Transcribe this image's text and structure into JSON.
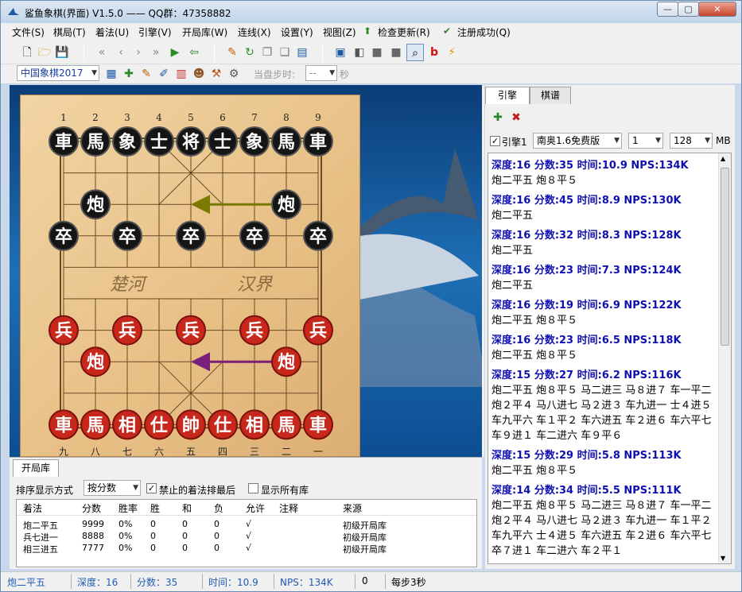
{
  "window": {
    "title": "鲨鱼象棋(界面) V1.5.0 —— QQ群：47358882",
    "min": "—",
    "max": "▢",
    "close": "✕"
  },
  "menu": [
    "文件(S)",
    "棋局(T)",
    "着法(U)",
    "引擎(V)",
    "开局库(W)",
    "连线(X)",
    "设置(Y)",
    "视图(Z)",
    "检查更新(R)",
    "注册成功(Q)"
  ],
  "toolbar2": {
    "board_style": "中国象棋2017",
    "step_label": "当盘步时:",
    "step_value": "--",
    "step_unit": "秒"
  },
  "board": {
    "top_numbers": [
      "1",
      "2",
      "3",
      "4",
      "5",
      "6",
      "7",
      "8",
      "9"
    ],
    "bottom_numbers": [
      "九",
      "八",
      "七",
      "六",
      "五",
      "四",
      "三",
      "二",
      "一"
    ],
    "river_left": "楚河",
    "river_right": "汉界",
    "black_pieces": [
      {
        "c": "車",
        "f": 0,
        "r": 0
      },
      {
        "c": "馬",
        "f": 1,
        "r": 0
      },
      {
        "c": "象",
        "f": 2,
        "r": 0
      },
      {
        "c": "士",
        "f": 3,
        "r": 0
      },
      {
        "c": "将",
        "f": 4,
        "r": 0
      },
      {
        "c": "士",
        "f": 5,
        "r": 0
      },
      {
        "c": "象",
        "f": 6,
        "r": 0
      },
      {
        "c": "馬",
        "f": 7,
        "r": 0
      },
      {
        "c": "車",
        "f": 8,
        "r": 0
      },
      {
        "c": "炮",
        "f": 1,
        "r": 2
      },
      {
        "c": "炮",
        "f": 7,
        "r": 2
      },
      {
        "c": "卒",
        "f": 0,
        "r": 3
      },
      {
        "c": "卒",
        "f": 2,
        "r": 3
      },
      {
        "c": "卒",
        "f": 4,
        "r": 3
      },
      {
        "c": "卒",
        "f": 6,
        "r": 3
      },
      {
        "c": "卒",
        "f": 8,
        "r": 3
      }
    ],
    "red_pieces": [
      {
        "c": "兵",
        "f": 0,
        "r": 6
      },
      {
        "c": "兵",
        "f": 2,
        "r": 6
      },
      {
        "c": "兵",
        "f": 4,
        "r": 6
      },
      {
        "c": "兵",
        "f": 6,
        "r": 6
      },
      {
        "c": "兵",
        "f": 8,
        "r": 6
      },
      {
        "c": "炮",
        "f": 1,
        "r": 7
      },
      {
        "c": "炮",
        "f": 7,
        "r": 7
      },
      {
        "c": "車",
        "f": 0,
        "r": 9
      },
      {
        "c": "馬",
        "f": 1,
        "r": 9
      },
      {
        "c": "相",
        "f": 2,
        "r": 9
      },
      {
        "c": "仕",
        "f": 3,
        "r": 9
      },
      {
        "c": "帥",
        "f": 4,
        "r": 9
      },
      {
        "c": "仕",
        "f": 5,
        "r": 9
      },
      {
        "c": "相",
        "f": 6,
        "r": 9
      },
      {
        "c": "馬",
        "f": 7,
        "r": 9
      },
      {
        "c": "車",
        "f": 8,
        "r": 9
      }
    ],
    "arrows": [
      {
        "from": [
          7,
          2
        ],
        "to": [
          4,
          2
        ],
        "color": "#7a7a00"
      },
      {
        "from": [
          7,
          7
        ],
        "to": [
          4,
          7
        ],
        "color": "#7a1f7a"
      }
    ]
  },
  "opening": {
    "tab": "开局库",
    "sort_label": "排序显示方式",
    "sort_value": "按分数",
    "chk_forbidden": "禁止的着法排最后",
    "chk_all": "显示所有库",
    "columns": [
      "着法",
      "分数",
      "胜率",
      "胜",
      "和",
      "负",
      "允许",
      "注释",
      "来源"
    ],
    "rows": [
      [
        "炮二平五",
        "9999",
        "0%",
        "0",
        "0",
        "0",
        "√",
        "",
        "初级开局库"
      ],
      [
        "兵七进一",
        "8888",
        "0%",
        "0",
        "0",
        "0",
        "√",
        "",
        "初级开局库"
      ],
      [
        "相三进五",
        "7777",
        "0%",
        "0",
        "0",
        "0",
        "√",
        "",
        "初级开局库"
      ]
    ]
  },
  "engine": {
    "tabs": [
      "引擎",
      "棋谱"
    ],
    "label": "引擎1",
    "name": "南奥1.6免费版",
    "threads": "1",
    "hash": "128",
    "hash_unit": "MB",
    "lines": [
      {
        "h": "深度:16  分数:35  时间:10.9  NPS:134K",
        "m": [
          "炮二平五 炮８平５"
        ]
      },
      {
        "h": "深度:16  分数:45  时间:8.9  NPS:130K",
        "m": [
          "炮二平五"
        ]
      },
      {
        "h": "深度:16  分数:32  时间:8.3  NPS:128K",
        "m": [
          "炮二平五"
        ]
      },
      {
        "h": "深度:16  分数:23  时间:7.3  NPS:124K",
        "m": [
          "炮二平五"
        ]
      },
      {
        "h": "深度:16  分数:19  时间:6.9  NPS:122K",
        "m": [
          "炮二平五 炮８平５"
        ]
      },
      {
        "h": "深度:16  分数:23  时间:6.5  NPS:118K",
        "m": [
          "炮二平五 炮８平５"
        ]
      },
      {
        "h": "深度:15  分数:27  时间:6.2  NPS:116K",
        "m": [
          "炮二平五 炮８平５ 马二进三 马８进７ 车一平二",
          "炮２平４ 马八进七 马２进３ 车九进一 士４进５",
          "车九平六 车１平２ 车六进五 车２进６ 车六平七",
          "车９进１ 车二进六 车９平６"
        ]
      },
      {
        "h": "深度:15  分数:29  时间:5.8  NPS:113K",
        "m": [
          "炮二平五 炮８平５"
        ]
      },
      {
        "h": "深度:14  分数:34  时间:5.5  NPS:111K",
        "m": [
          "炮二平五 炮８平５ 马二进三 马８进７ 车一平二",
          "炮２平４ 马八进七 马２进３ 车九进一 车１平２",
          "车九平六 士４进５ 车六进五 车２进６ 车六平七",
          "卒７进１ 车二进六 车２平１"
        ]
      }
    ]
  },
  "status": {
    "move": "炮二平五",
    "depth": "深度：16",
    "score": "分数：35",
    "time": "时间：10.9",
    "nps": "NPS：134K",
    "zero": "0",
    "per_step": "每步3秒"
  }
}
